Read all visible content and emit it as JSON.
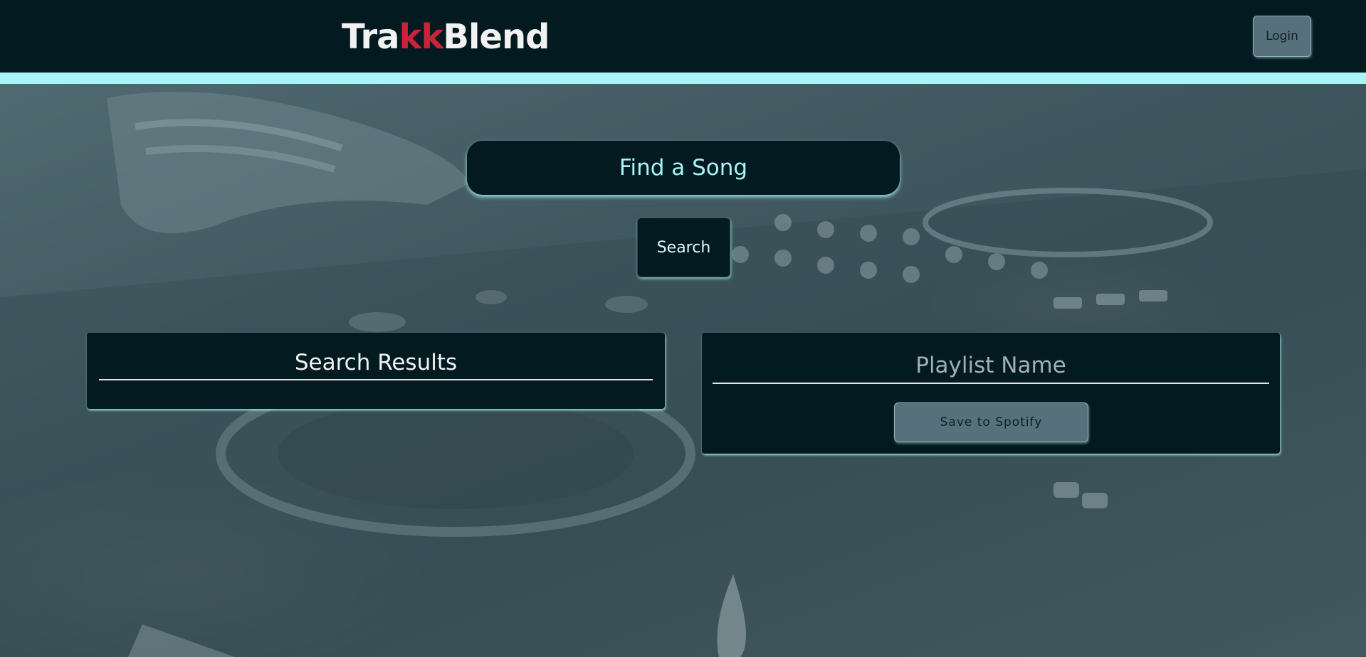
{
  "header": {
    "logo": {
      "part1": "Tra",
      "part2": "kk",
      "part3": "Blend"
    },
    "login_label": "Login"
  },
  "search": {
    "placeholder": "Find a Song",
    "button_label": "Search"
  },
  "results": {
    "title": "Search Results"
  },
  "playlist": {
    "name_placeholder": "Playlist Name",
    "save_label": "Save to Spotify"
  },
  "colors": {
    "header_bg": "#031a20",
    "accent_stripe": "#a8f5f8",
    "logo_accent": "#c8233b",
    "button_bg": "#56717b",
    "panel_bg": "#031a20"
  }
}
